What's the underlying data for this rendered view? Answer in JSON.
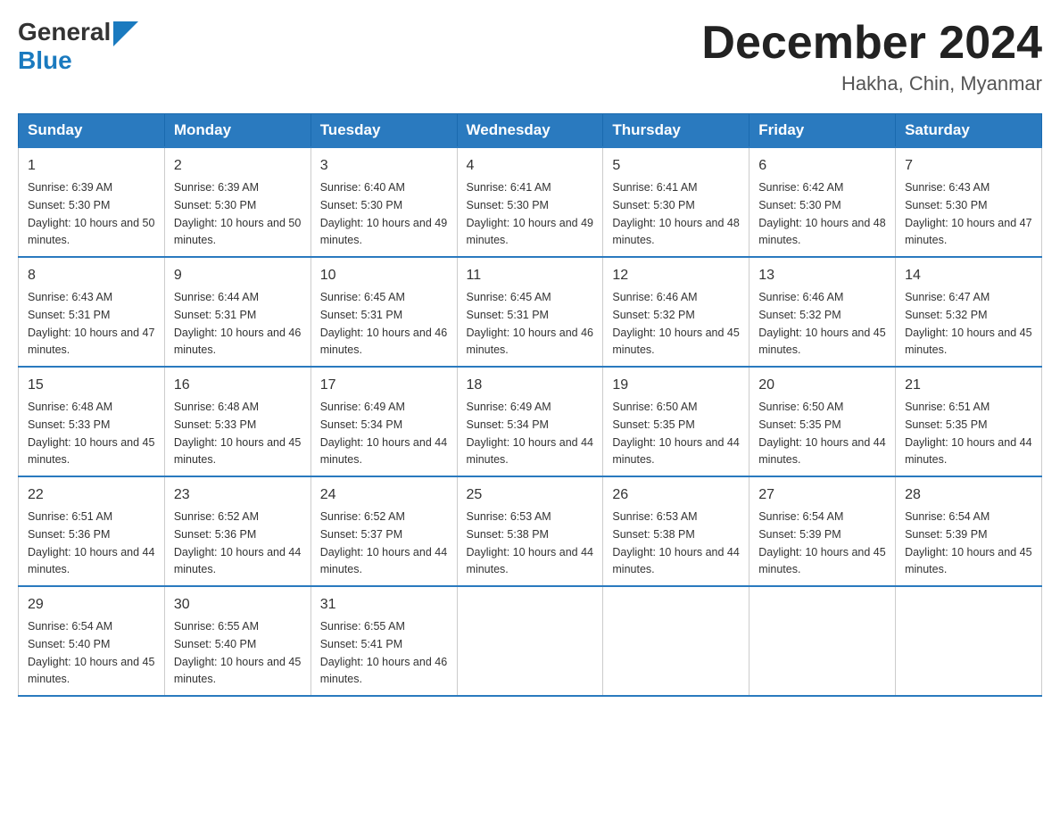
{
  "header": {
    "logo_general": "General",
    "logo_blue": "Blue",
    "month_year": "December 2024",
    "location": "Hakha, Chin, Myanmar"
  },
  "weekdays": [
    "Sunday",
    "Monday",
    "Tuesday",
    "Wednesday",
    "Thursday",
    "Friday",
    "Saturday"
  ],
  "weeks": [
    [
      {
        "day": "1",
        "sunrise": "6:39 AM",
        "sunset": "5:30 PM",
        "daylight": "10 hours and 50 minutes."
      },
      {
        "day": "2",
        "sunrise": "6:39 AM",
        "sunset": "5:30 PM",
        "daylight": "10 hours and 50 minutes."
      },
      {
        "day": "3",
        "sunrise": "6:40 AM",
        "sunset": "5:30 PM",
        "daylight": "10 hours and 49 minutes."
      },
      {
        "day": "4",
        "sunrise": "6:41 AM",
        "sunset": "5:30 PM",
        "daylight": "10 hours and 49 minutes."
      },
      {
        "day": "5",
        "sunrise": "6:41 AM",
        "sunset": "5:30 PM",
        "daylight": "10 hours and 48 minutes."
      },
      {
        "day": "6",
        "sunrise": "6:42 AM",
        "sunset": "5:30 PM",
        "daylight": "10 hours and 48 minutes."
      },
      {
        "day": "7",
        "sunrise": "6:43 AM",
        "sunset": "5:30 PM",
        "daylight": "10 hours and 47 minutes."
      }
    ],
    [
      {
        "day": "8",
        "sunrise": "6:43 AM",
        "sunset": "5:31 PM",
        "daylight": "10 hours and 47 minutes."
      },
      {
        "day": "9",
        "sunrise": "6:44 AM",
        "sunset": "5:31 PM",
        "daylight": "10 hours and 46 minutes."
      },
      {
        "day": "10",
        "sunrise": "6:45 AM",
        "sunset": "5:31 PM",
        "daylight": "10 hours and 46 minutes."
      },
      {
        "day": "11",
        "sunrise": "6:45 AM",
        "sunset": "5:31 PM",
        "daylight": "10 hours and 46 minutes."
      },
      {
        "day": "12",
        "sunrise": "6:46 AM",
        "sunset": "5:32 PM",
        "daylight": "10 hours and 45 minutes."
      },
      {
        "day": "13",
        "sunrise": "6:46 AM",
        "sunset": "5:32 PM",
        "daylight": "10 hours and 45 minutes."
      },
      {
        "day": "14",
        "sunrise": "6:47 AM",
        "sunset": "5:32 PM",
        "daylight": "10 hours and 45 minutes."
      }
    ],
    [
      {
        "day": "15",
        "sunrise": "6:48 AM",
        "sunset": "5:33 PM",
        "daylight": "10 hours and 45 minutes."
      },
      {
        "day": "16",
        "sunrise": "6:48 AM",
        "sunset": "5:33 PM",
        "daylight": "10 hours and 45 minutes."
      },
      {
        "day": "17",
        "sunrise": "6:49 AM",
        "sunset": "5:34 PM",
        "daylight": "10 hours and 44 minutes."
      },
      {
        "day": "18",
        "sunrise": "6:49 AM",
        "sunset": "5:34 PM",
        "daylight": "10 hours and 44 minutes."
      },
      {
        "day": "19",
        "sunrise": "6:50 AM",
        "sunset": "5:35 PM",
        "daylight": "10 hours and 44 minutes."
      },
      {
        "day": "20",
        "sunrise": "6:50 AM",
        "sunset": "5:35 PM",
        "daylight": "10 hours and 44 minutes."
      },
      {
        "day": "21",
        "sunrise": "6:51 AM",
        "sunset": "5:35 PM",
        "daylight": "10 hours and 44 minutes."
      }
    ],
    [
      {
        "day": "22",
        "sunrise": "6:51 AM",
        "sunset": "5:36 PM",
        "daylight": "10 hours and 44 minutes."
      },
      {
        "day": "23",
        "sunrise": "6:52 AM",
        "sunset": "5:36 PM",
        "daylight": "10 hours and 44 minutes."
      },
      {
        "day": "24",
        "sunrise": "6:52 AM",
        "sunset": "5:37 PM",
        "daylight": "10 hours and 44 minutes."
      },
      {
        "day": "25",
        "sunrise": "6:53 AM",
        "sunset": "5:38 PM",
        "daylight": "10 hours and 44 minutes."
      },
      {
        "day": "26",
        "sunrise": "6:53 AM",
        "sunset": "5:38 PM",
        "daylight": "10 hours and 44 minutes."
      },
      {
        "day": "27",
        "sunrise": "6:54 AM",
        "sunset": "5:39 PM",
        "daylight": "10 hours and 45 minutes."
      },
      {
        "day": "28",
        "sunrise": "6:54 AM",
        "sunset": "5:39 PM",
        "daylight": "10 hours and 45 minutes."
      }
    ],
    [
      {
        "day": "29",
        "sunrise": "6:54 AM",
        "sunset": "5:40 PM",
        "daylight": "10 hours and 45 minutes."
      },
      {
        "day": "30",
        "sunrise": "6:55 AM",
        "sunset": "5:40 PM",
        "daylight": "10 hours and 45 minutes."
      },
      {
        "day": "31",
        "sunrise": "6:55 AM",
        "sunset": "5:41 PM",
        "daylight": "10 hours and 46 minutes."
      },
      null,
      null,
      null,
      null
    ]
  ]
}
